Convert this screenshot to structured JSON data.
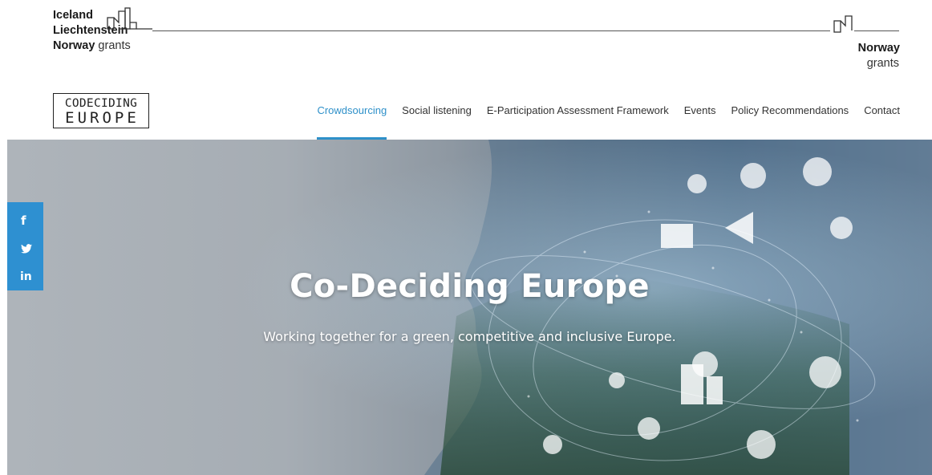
{
  "grants": {
    "left_line1": "Iceland",
    "left_line2": "Liechtenstein",
    "left_line3_bold": "Norway",
    "left_line3_light": "grants",
    "right_bold": "Norway",
    "right_light": "grants"
  },
  "site": {
    "logo_line1": "CODECIDING",
    "logo_line2": "EUROPE"
  },
  "nav": {
    "items": [
      {
        "label": "Crowdsourcing",
        "active": true
      },
      {
        "label": "Social listening"
      },
      {
        "label": "E-Participation Assessment Framework"
      },
      {
        "label": "Events"
      },
      {
        "label": "Policy Recommendations"
      },
      {
        "label": "Contact"
      }
    ]
  },
  "hero": {
    "title": "Co-Deciding Europe",
    "subtitle": "Working together for a green, competitive and inclusive Europe."
  },
  "social": {
    "facebook_glyph": "f",
    "linkedin_glyph": "in"
  },
  "colors": {
    "accent": "#2e90c9",
    "social_bg": "#2e90d1"
  }
}
